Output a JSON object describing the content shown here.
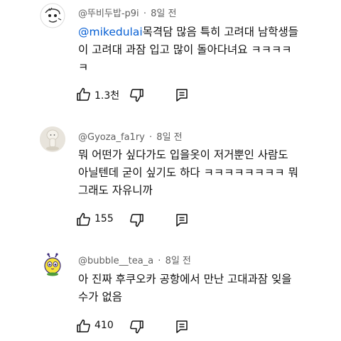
{
  "comments": [
    {
      "author": "@뚜비두밥-p9i",
      "time": "8일 전",
      "mention": "@mikedulai",
      "line1_rest": "목격담 많음 특히 고려대 남학생들",
      "line2": "이 고려대 과잠 입고 많이 돌아다녀요 ㅋㅋㅋㅋ",
      "line3": "ㅋ",
      "likes": "1.3천",
      "avatar_icon": "doodle-face-icon"
    },
    {
      "author": "@Gyoza_fa1ry",
      "time": "8일 전",
      "line1": "뭐 어떤가 싶다가도 입을옷이 저거뿐인 사람도",
      "line2": "아닐텐데 굳이 싶기도 하다 ㅋㅋㅋㅋㅋㅋㅋㅋ 뭐",
      "line3": "그래도 자유니까",
      "likes": "155",
      "avatar_icon": "figurine-icon"
    },
    {
      "author": "@bubble__tea_a",
      "time": "8일 전",
      "line1": "아 진짜 후쿠오카 공항에서 만난 고대과잠 잊을",
      "line2": "수가 없음",
      "likes": "410",
      "avatar_icon": "yellow-character-icon"
    }
  ],
  "separator": "·"
}
